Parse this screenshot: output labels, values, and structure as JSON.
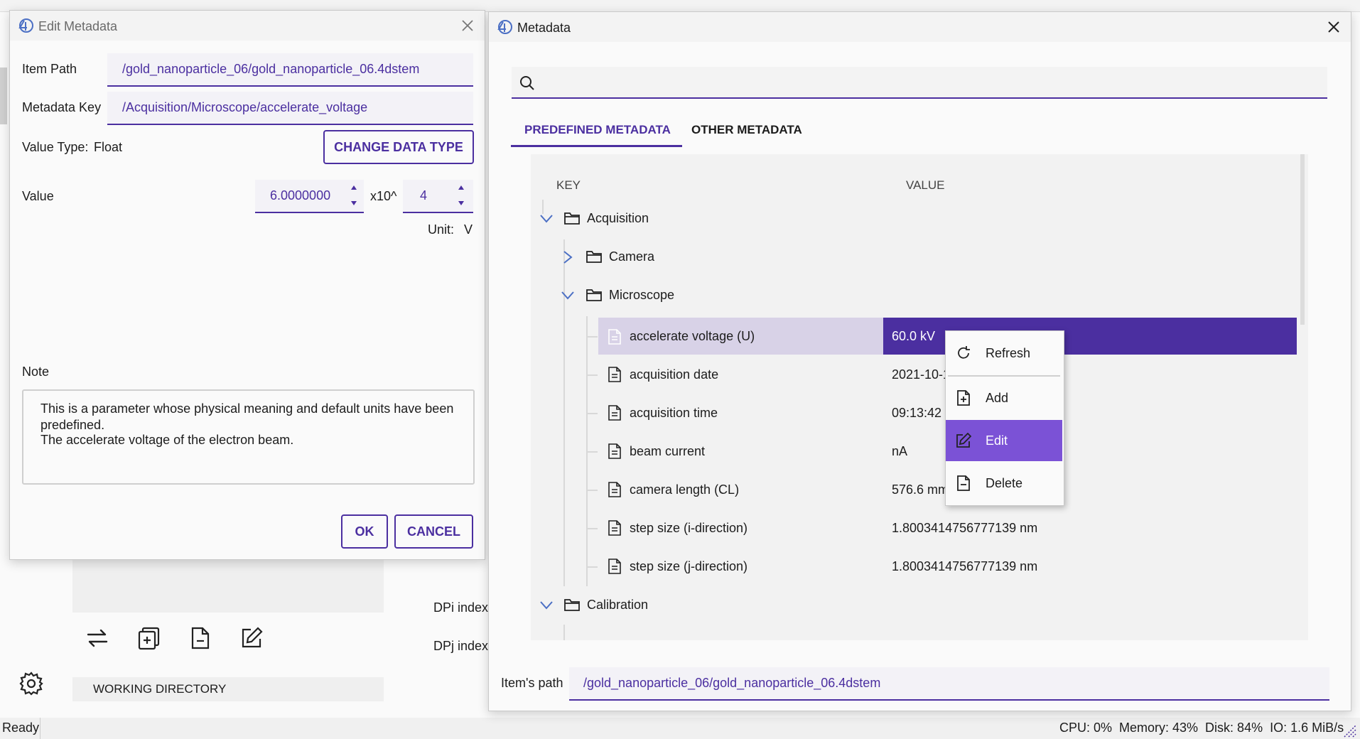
{
  "background_window": {
    "labels": {
      "dpi_index": "DPi index",
      "dpj_index": "DPj index"
    },
    "working_directory": "WORKING DIRECTORY"
  },
  "status_bar": {
    "status": "Ready",
    "metrics": "CPU: 0%  Memory: 43%  Disk: 84%  IO: 1.6 MiB/s"
  },
  "edit_dialog": {
    "title": "Edit Metadata",
    "item_path_label": "Item Path",
    "item_path_value": "/gold_nanoparticle_06/gold_nanoparticle_06.4dstem",
    "metadata_key_label": "Metadata Key",
    "metadata_key_value": "/Acquisition/Microscope/accelerate_voltage",
    "value_type_label": "Value Type:",
    "value_type": "Float",
    "change_type_button": "CHANGE DATA TYPE",
    "value_label": "Value",
    "mantissa": "6.0000000",
    "exp_label": "x10^",
    "exponent": "4",
    "unit_label": "Unit:",
    "unit": "V",
    "note_label": "Note",
    "note_line1": "This is a parameter whose physical meaning and default units have been predefined.",
    "note_line2": "The accelerate voltage of the electron beam.",
    "ok": "OK",
    "cancel": "CANCEL"
  },
  "metadata_window": {
    "title": "Metadata",
    "search_placeholder": "",
    "tabs": [
      "PREDEFINED METADATA",
      "OTHER METADATA"
    ],
    "columns": {
      "key": "KEY",
      "value": "VALUE"
    },
    "tree": {
      "acquisition": "Acquisition",
      "camera": "Camera",
      "microscope": "Microscope",
      "calibration": "Calibration",
      "rows": [
        {
          "key": "accelerate voltage (U)",
          "value": "60.0 kV"
        },
        {
          "key": "acquisition date",
          "value": "2021-10-1"
        },
        {
          "key": "acquisition time",
          "value": "09:13:42"
        },
        {
          "key": "beam current",
          "value": "nA"
        },
        {
          "key": "camera length (CL)",
          "value": "576.6 mm"
        },
        {
          "key": "step size (i-direction)",
          "value": "1.8003414756777139 nm"
        },
        {
          "key": "step size (j-direction)",
          "value": "1.8003414756777139 nm"
        }
      ]
    },
    "items_path_label": "Item's path",
    "items_path_value": "/gold_nanoparticle_06/gold_nanoparticle_06.4dstem"
  },
  "context_menu": {
    "items": [
      "Refresh",
      "Add",
      "Edit",
      "Delete"
    ]
  },
  "colors": {
    "accent": "#4b2fa0",
    "selected_row": "#4b2fa0",
    "menu_highlight": "#7b52d6"
  }
}
